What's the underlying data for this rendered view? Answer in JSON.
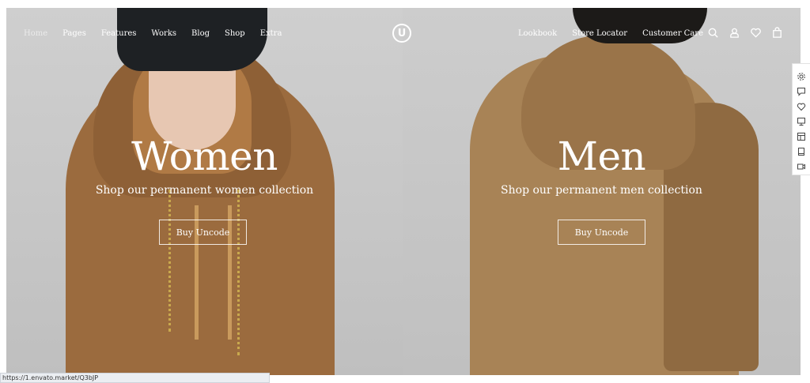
{
  "nav": {
    "left_items": [
      {
        "label": "Home"
      },
      {
        "label": "Pages"
      },
      {
        "label": "Features"
      },
      {
        "label": "Works"
      },
      {
        "label": "Blog"
      },
      {
        "label": "Shop"
      },
      {
        "label": "Extra"
      }
    ],
    "logo_text": "U",
    "right_items": [
      {
        "label": "Lookbook"
      },
      {
        "label": "Store Locator"
      },
      {
        "label": "Customer Care"
      }
    ],
    "icons": [
      "search-icon",
      "user-icon",
      "heart-icon",
      "bag-icon"
    ]
  },
  "women": {
    "headline": "Women",
    "subtitle": "Shop our permanent women collection",
    "button_label": "Buy Uncode"
  },
  "men": {
    "headline": "Men",
    "subtitle": "Shop our permanent men collection",
    "button_label": "Buy Uncode"
  },
  "side_tools": [
    "gear-icon",
    "comment-icon",
    "heart-icon",
    "monitor-icon",
    "layout-icon",
    "book-icon",
    "video-icon"
  ],
  "status_bar": {
    "url": "https://1.envato.market/Q3bJP"
  },
  "colors": {
    "text_on_hero": "#ffffff",
    "hoodie_brown": "#9b6b3e",
    "hero_gray": "#c9c9c9"
  }
}
